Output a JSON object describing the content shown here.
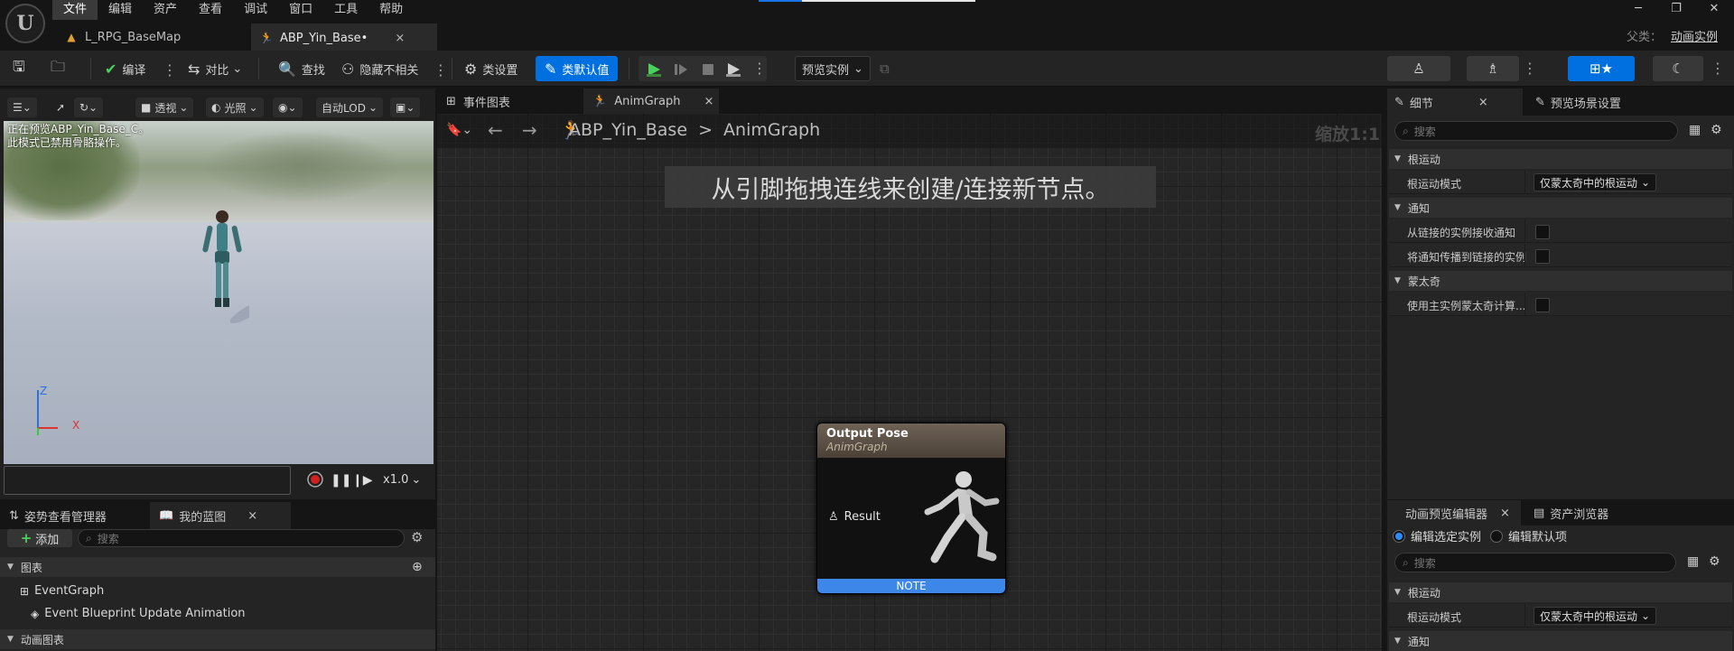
{
  "menu": [
    "文件",
    "编辑",
    "资产",
    "查看",
    "调试",
    "窗口",
    "工具",
    "帮助"
  ],
  "logo_letter": "U",
  "window_controls": [
    "─",
    "❐",
    "✕"
  ],
  "doc_tabs": [
    {
      "label": "L_RPG_BaseMap"
    },
    {
      "label": "ABP_Yin_Base•",
      "close": "×"
    }
  ],
  "parent_class": {
    "label": "父类：",
    "value": "动画实例"
  },
  "toolbar": {
    "compile": "编译",
    "diff": "对比",
    "find": "查找",
    "hide_unrelated": "隐藏不相关",
    "class_settings": "类设置",
    "class_defaults": "类默认值",
    "preview_instance": "预览实例"
  },
  "viewport": {
    "buttons": [
      "透视",
      "光照",
      "自动LOD"
    ],
    "overlay_line1": "正在预览ABP_Yin_Base_C。",
    "overlay_line2": "此模式已禁用骨骼操作。",
    "axis_z": "Z",
    "axis_x": "X",
    "playback_speed": "x1.0"
  },
  "left_bottom": {
    "tabs": [
      "姿势查看管理器",
      "我的蓝图"
    ],
    "tab_close": "×",
    "add_label": "添加",
    "search_placeholder": "搜索",
    "section_graphs": "图表",
    "event_graph": "EventGraph",
    "event_item": "Event Blueprint Update Animation",
    "section_anim_graphs": "动画图表"
  },
  "graph": {
    "tabs": [
      "事件图表",
      "AnimGraph"
    ],
    "tab_close": "×",
    "breadcrumb_root": "ABP_Yin_Base",
    "breadcrumb_sep": ">",
    "breadcrumb_leaf": "AnimGraph",
    "zoom": "缩放1:1",
    "hint": "从引脚拖拽连线来创建/连接新节点。",
    "node_title": "Output Pose",
    "node_subtitle": "AnimGraph",
    "node_pin": "Result",
    "node_note": "NOTE"
  },
  "details": {
    "tabs": [
      "细节",
      "预览场景设置"
    ],
    "tab_close": "×",
    "search_placeholder": "搜索",
    "cat_root_motion": "根运动",
    "root_motion_mode_label": "根运动模式",
    "root_motion_mode_value": "仅蒙太奇中的根运动",
    "cat_notify": "通知",
    "notify_receive_label": "从链接的实例接收通知",
    "notify_propagate_label": "将通知传播到链接的实例",
    "cat_montage": "蒙太奇",
    "montage_main_label": "使用主实例蒙太奇计算..."
  },
  "anim_preview": {
    "tabs": [
      "动画预览编辑器",
      "资产浏览器"
    ],
    "tab_close": "×",
    "radio_selected": "编辑选定实例",
    "radio_default": "编辑默认项",
    "search_placeholder": "搜索",
    "cat_root_motion": "根运动",
    "root_motion_mode_label": "根运动模式",
    "root_motion_mode_value": "仅蒙太奇中的根运动",
    "cat_notify": "通知"
  },
  "colors": {
    "accent_blue": "#0070e0",
    "play_green": "#4bd15b",
    "note_blue": "#3d87e8",
    "record_red": "#d02020"
  }
}
